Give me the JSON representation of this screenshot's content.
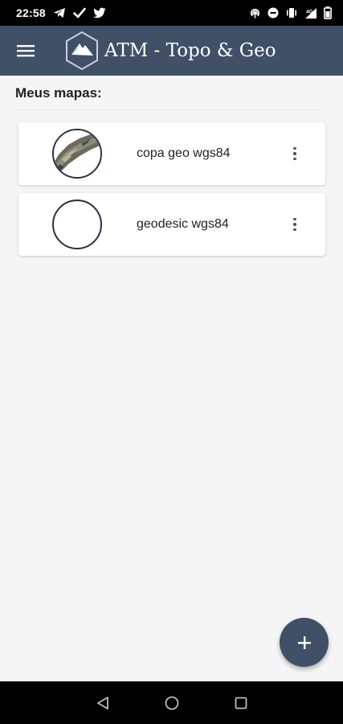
{
  "status_bar": {
    "time": "22:58",
    "left_icons": [
      "telegram-icon",
      "check-icon",
      "twitter-icon"
    ],
    "right_icons": [
      "hotspot-icon",
      "do-not-disturb-icon",
      "vibrate-icon",
      "signal-icon",
      "battery-icon"
    ],
    "signal_label": "4G"
  },
  "app_bar": {
    "title": "ATM - Topo & Geo",
    "menu_icon": "hamburger-menu-icon",
    "logo_icon": "mountain-hexagon-logo",
    "color": "#3f5067"
  },
  "main": {
    "section_title": "Meus mapas:",
    "maps": [
      {
        "name": "copa geo wgs84",
        "thumbnail": "satellite-map-thumbnail"
      },
      {
        "name": "geodesic wgs84",
        "thumbnail": "empty-map-thumbnail"
      }
    ]
  },
  "fab": {
    "icon": "plus-icon",
    "color": "#3f5067"
  },
  "nav_bar": {
    "icons": [
      "back-icon",
      "home-icon",
      "recents-icon"
    ]
  }
}
